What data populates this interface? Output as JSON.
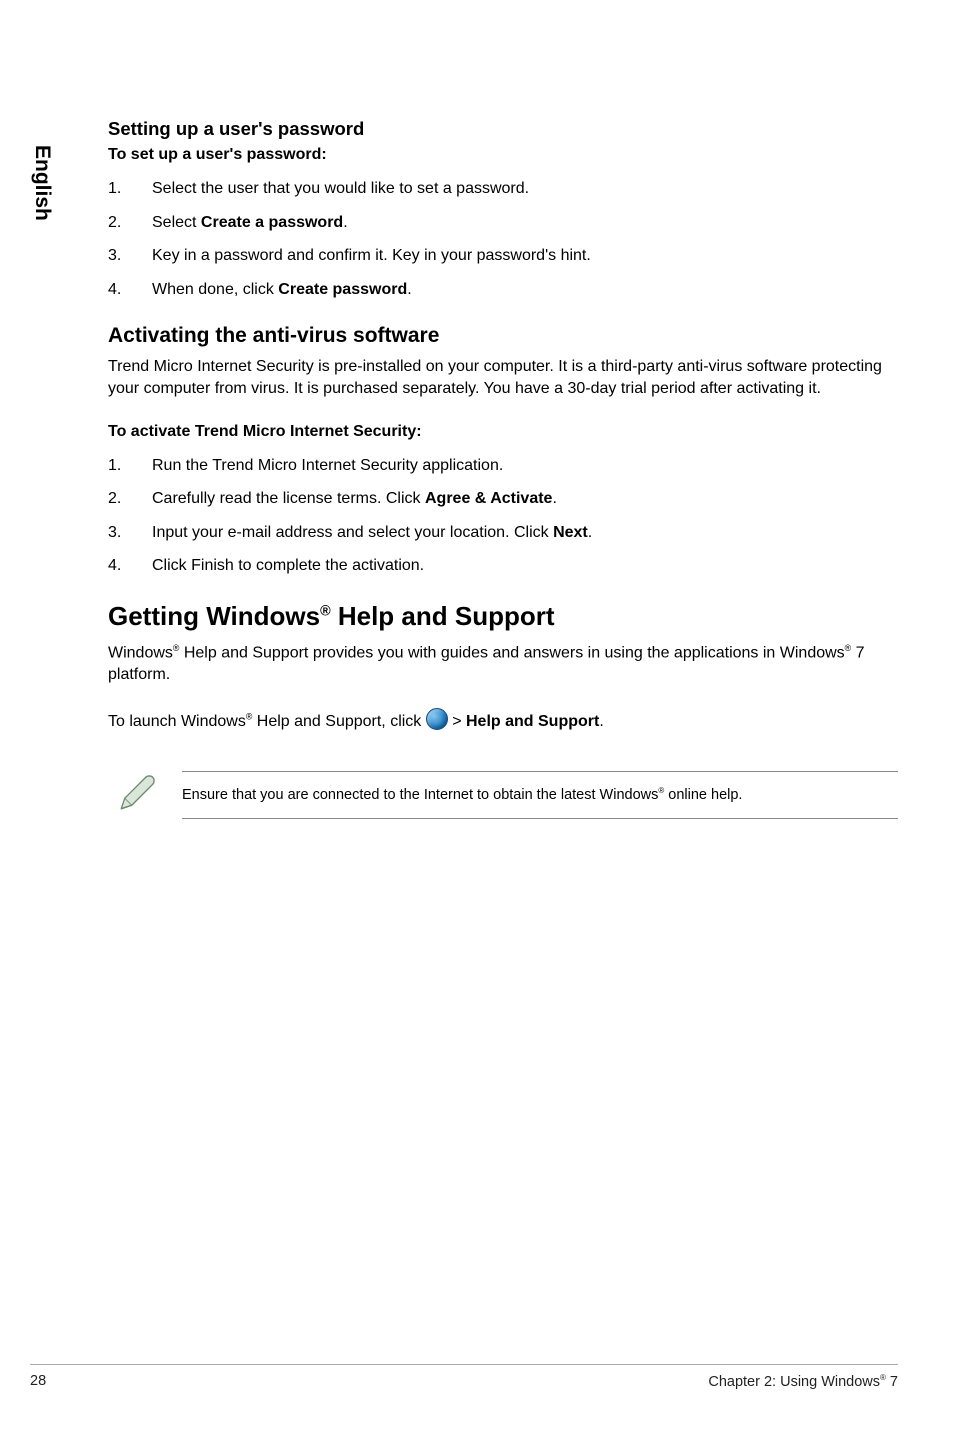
{
  "side_tab": "English",
  "section1": {
    "title": "Setting up a user's password",
    "lead": "To set up a user's password:",
    "steps": [
      {
        "num": "1.",
        "pre": "Select the user that you would like to set a password."
      },
      {
        "num": "2.",
        "pre": "Select ",
        "bold": "Create a password",
        "post": "."
      },
      {
        "num": "3.",
        "pre": "Key in a password and confirm it. Key in your password's hint."
      },
      {
        "num": "4.",
        "pre": "When done, click ",
        "bold": "Create password",
        "post": "."
      }
    ]
  },
  "section2": {
    "title": "Activating the anti-virus software",
    "intro": "Trend Micro Internet Security is pre-installed on your computer. It is a third-party anti-virus software protecting your computer from virus. It is purchased separately. You have a 30-day trial period after activating it.",
    "lead": "To activate Trend Micro Internet Security:",
    "steps": [
      {
        "num": "1.",
        "pre": "Run the Trend Micro Internet Security application."
      },
      {
        "num": "2.",
        "pre": "Carefully read the license terms. Click ",
        "bold": "Agree & Activate",
        "post": "."
      },
      {
        "num": "3.",
        "pre": "Input your e-mail address and select your location. Click ",
        "bold": "Next",
        "post": "."
      },
      {
        "num": "4.",
        "pre": "Click Finish to complete the activation."
      }
    ]
  },
  "section3": {
    "title_pre": "Getting Windows",
    "title_sup": "®",
    "title_post": " Help and Support",
    "p1_a": "Windows",
    "p1_sup1": "®",
    "p1_b": " Help and Support provides you with guides and answers in using the applications in Windows",
    "p1_sup2": "®",
    "p1_c": " 7 platform.",
    "p2_a": "To launch Windows",
    "p2_sup": "®",
    "p2_b": " Help and Support, click ",
    "p2_gt": " > ",
    "p2_bold": "Help and Support",
    "p2_post": ".",
    "note_a": "Ensure that you are connected to the Internet to obtain the latest Windows",
    "note_sup": "®",
    "note_b": " online help."
  },
  "footer": {
    "page": "28",
    "chapter_a": "Chapter 2: Using Windows",
    "chapter_sup": "®",
    "chapter_b": " 7"
  }
}
